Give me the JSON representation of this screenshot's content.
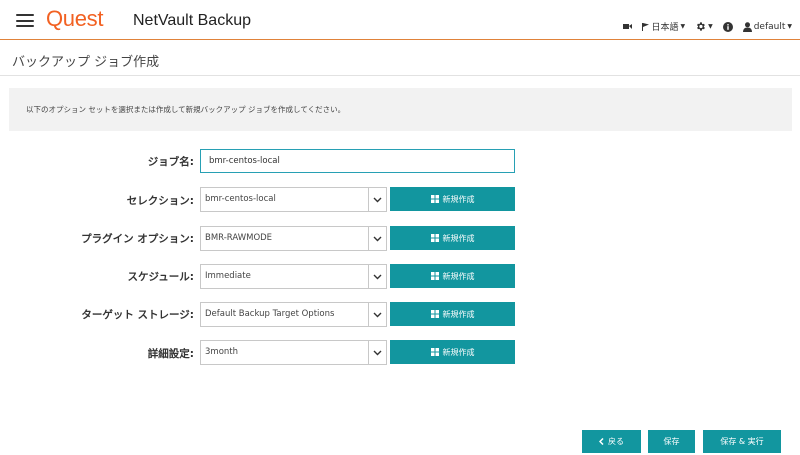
{
  "header": {
    "logo": "Quest",
    "app_title": "NetVault Backup",
    "language": "日本語",
    "user": "default"
  },
  "page": {
    "title": "バックアップ ジョブ作成",
    "info": "以下のオプション セットを選択または作成して新規バックアップ ジョブを作成してください。"
  },
  "form": {
    "job_name_label": "ジョブ名:",
    "job_name_value": "bmr-centos-local",
    "rows": [
      {
        "label": "セレクション:",
        "value": "bmr-centos-local",
        "button": "新規作成"
      },
      {
        "label": "プラグイン オプション:",
        "value": "BMR-RAWMODE",
        "button": "新規作成"
      },
      {
        "label": "スケジュール:",
        "value": "Immediate",
        "button": "新規作成"
      },
      {
        "label": "ターゲット ストレージ:",
        "value": "Default Backup Target Options",
        "button": "新規作成"
      },
      {
        "label": "詳細設定:",
        "value": "3month",
        "button": "新規作成"
      }
    ]
  },
  "footer": {
    "back": "戻る",
    "save": "保存",
    "save_run": "保存 & 実行"
  },
  "colors": {
    "brand": "#f26122",
    "button": "#12969f",
    "focus": "#27a0b4"
  }
}
